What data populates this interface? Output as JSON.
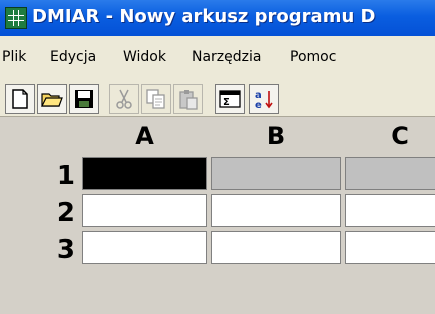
{
  "window": {
    "title": "DMIAR - Nowy arkusz programu D",
    "icon": "spreadsheet-app-icon"
  },
  "menu": [
    "Plik",
    "Edycja",
    "Widok",
    "Narzędzia",
    "Pomoc"
  ],
  "toolbar": {
    "buttons": [
      {
        "icon": "new-file-icon",
        "enabled": true
      },
      {
        "icon": "open-folder-icon",
        "enabled": true
      },
      {
        "icon": "save-icon",
        "enabled": true
      },
      {
        "icon": "cut-icon",
        "enabled": false
      },
      {
        "icon": "copy-icon",
        "enabled": false
      },
      {
        "icon": "paste-icon",
        "enabled": false
      },
      {
        "icon": "formula-icon",
        "enabled": true
      },
      {
        "icon": "sort-az-icon",
        "enabled": true
      }
    ]
  },
  "sheet": {
    "columns": [
      "A",
      "B",
      "C"
    ],
    "rows": [
      "1",
      "2",
      "3"
    ],
    "cells": [
      {
        "row": "1",
        "col": "A",
        "fill": "#000000"
      },
      {
        "row": "1",
        "col": "B",
        "fill": "#c0c0c0"
      },
      {
        "row": "1",
        "col": "C",
        "fill": "#c0c0c0"
      },
      {
        "row": "2",
        "col": "A",
        "fill": "#ffffff"
      },
      {
        "row": "2",
        "col": "B",
        "fill": "#ffffff"
      },
      {
        "row": "2",
        "col": "C",
        "fill": "#ffffff"
      },
      {
        "row": "3",
        "col": "A",
        "fill": "#ffffff"
      },
      {
        "row": "3",
        "col": "B",
        "fill": "#ffffff"
      },
      {
        "row": "3",
        "col": "C",
        "fill": "#ffffff"
      }
    ]
  },
  "colors": {
    "titlebar": "#0a5ee0",
    "window_bg": "#ece9d8",
    "grid_bg": "#d4d0c8"
  }
}
